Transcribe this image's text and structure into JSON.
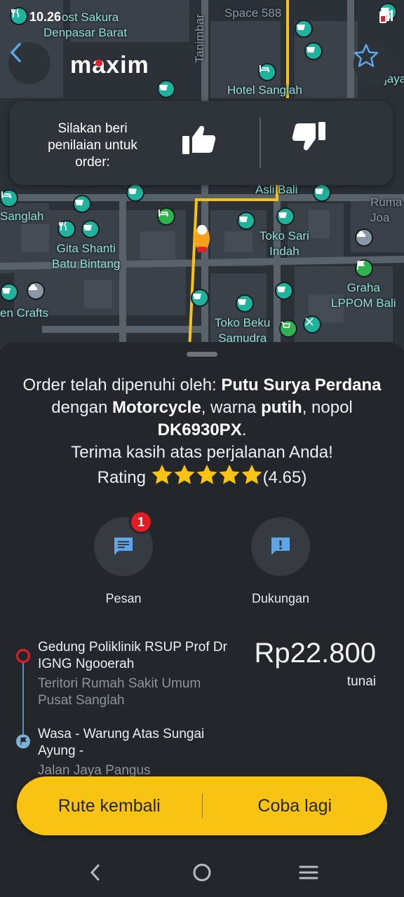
{
  "status_bar": {
    "time": "10.26"
  },
  "map": {
    "labels": {
      "sakura": "ost Sakura",
      "denpasar": "Denpasar Barat",
      "tanimbar": "Tanimbar",
      "space": "Space 588",
      "hotel": "Hotel Sanglah",
      "asli": "Asli Bali",
      "sanglah": "Sanglah",
      "gita": "Gita Shanti\nBatu Bintang",
      "toko_sari": "Toko Sari\nIndah",
      "graha": "Graha\nLPPOM Bali",
      "crafts": "en Crafts",
      "toko_beku": "Toko Beku\nSamudra",
      "ruma": "Ruma\nJoa",
      "jaya": "jaya"
    }
  },
  "header": {
    "logo": "maxim"
  },
  "rating_card": {
    "prompt": "Silakan beri penilaian untuk order:"
  },
  "order": {
    "line1_prefix": "Order telah dipenuhi oleh: ",
    "driver_name": "Putu Surya Perdana",
    "with": " dengan ",
    "vehicle": "Motorcycle",
    "color_prefix": ", warna ",
    "color": "putih",
    "plate_prefix": ", nopol ",
    "plate": "DK6930PX",
    "plate_suffix": ".",
    "thanks": "Terima kasih atas perjalanan Anda!",
    "rating_label": "Rating",
    "stars": 5,
    "rating_value": "(4.65)"
  },
  "actions": {
    "message_label": "Pesan",
    "message_badge": "1",
    "support_label": "Dukungan"
  },
  "route": {
    "from_title": "Gedung Poliklinik RSUP Prof Dr IGNG Ngooerah",
    "from_sub": "Teritori Rumah Sakit Umum Pusat Sanglah",
    "to_title": "Wasa - Warung Atas Sungai Ayung -",
    "to_sub": "Jalan Jaya Pangus",
    "price": "Rp22.800",
    "payment": "tunai"
  },
  "buttons": {
    "return_route": "Rute kembali",
    "retry": "Coba lagi"
  },
  "colors": {
    "accent_yellow": "#f8c313",
    "badge_red": "#e31b23",
    "poi_teal": "#1fb39d"
  }
}
